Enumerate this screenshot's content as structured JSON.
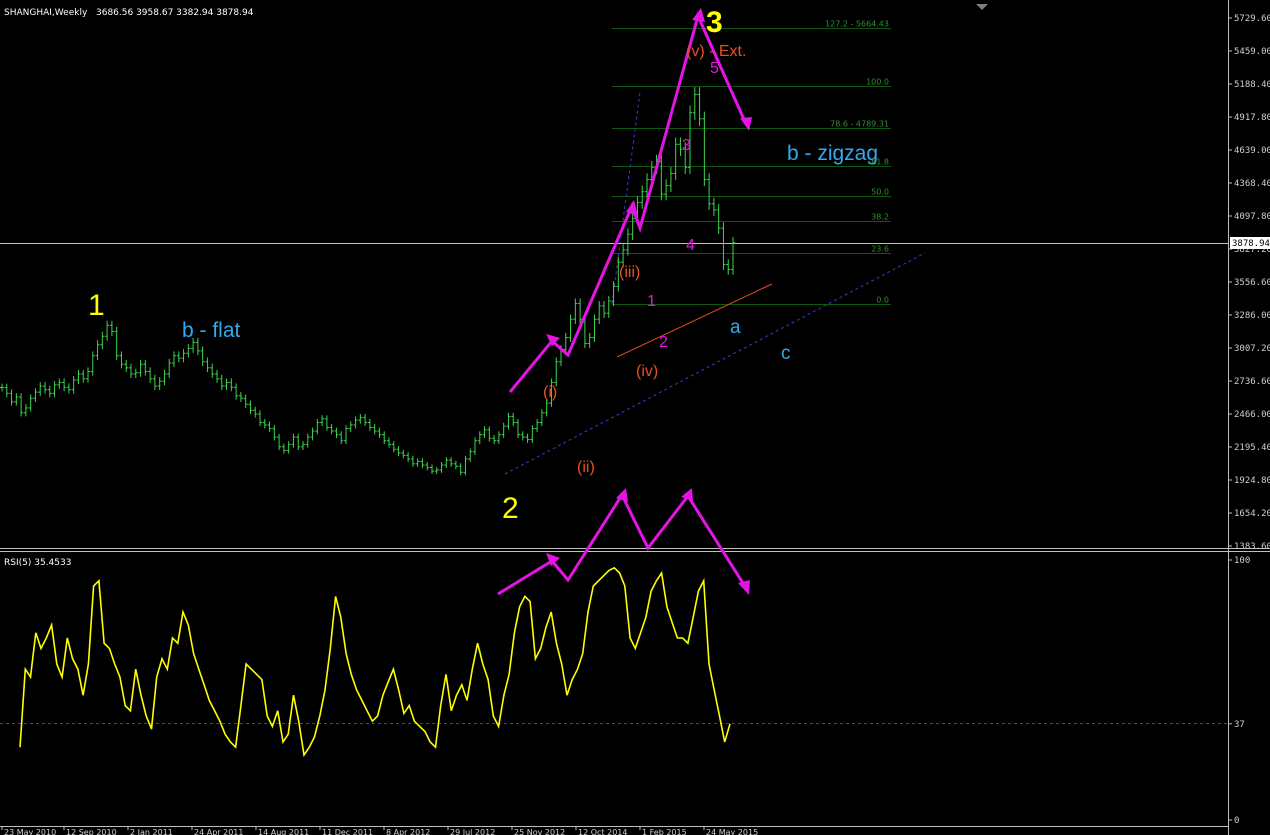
{
  "header": {
    "symbol": "SHANGHAI,Weekly",
    "ohlc": "3686.56 3958.67 3382.94 3878.94"
  },
  "rsi_header": "RSI(5) 35.4533",
  "current_price_label": "3878.94",
  "colors": {
    "background": "#000000",
    "candles": "#3cd64c",
    "rsi_line": "#ffff00",
    "wave_arrows": "#e414e4",
    "fib_lines": "#0f5a0f",
    "trendline": "#3a3ad0",
    "support_line": "#e04a20",
    "primary_wave_labels": "#ffff00",
    "corrective_labels": "#33aaee",
    "minor_wave_labels": "#e85020",
    "minute_wave_labels": "#e414e4"
  },
  "chart_data": [
    {
      "type": "candlestick",
      "title": "SHANGHAI,Weekly",
      "price_axis_ticks": [
        "5729.60",
        "5459.00",
        "5188.40",
        "4917.80",
        "4639.00",
        "4368.40",
        "4097.80",
        "3827.20",
        "3556.60",
        "3286.00",
        "3007.20",
        "2736.60",
        "2466.00",
        "2195.40",
        "1924.80",
        "1654.20",
        "1383.60"
      ],
      "date_axis_ticks": [
        "23 May 2010",
        "12 Sep 2010",
        "2 Jan 2011",
        "24 Apr 2011",
        "14 Aug 2011",
        "11 Dec 2011",
        "8 Apr 2012",
        "29 Jul 2012",
        "25 Nov 2012",
        "12 Oct 2014",
        "1 Feb 2015",
        "24 May 2015"
      ],
      "ylim": [
        1383.6,
        5729.6
      ],
      "weekly_closes": [
        2688,
        2640,
        2570,
        2610,
        2480,
        2520,
        2600,
        2650,
        2700,
        2670,
        2640,
        2710,
        2730,
        2690,
        2670,
        2750,
        2800,
        2760,
        2820,
        2950,
        3040,
        3110,
        3200,
        3150,
        2950,
        2880,
        2850,
        2800,
        2810,
        2880,
        2820,
        2760,
        2700,
        2740,
        2800,
        2890,
        2950,
        2930,
        2970,
        3010,
        3060,
        2990,
        2900,
        2850,
        2800,
        2760,
        2700,
        2730,
        2690,
        2620,
        2600,
        2550,
        2500,
        2470,
        2400,
        2380,
        2350,
        2280,
        2200,
        2170,
        2220,
        2280,
        2200,
        2220,
        2280,
        2330,
        2400,
        2430,
        2360,
        2330,
        2300,
        2250,
        2350,
        2380,
        2420,
        2440,
        2400,
        2360,
        2330,
        2300,
        2250,
        2220,
        2180,
        2150,
        2130,
        2100,
        2060,
        2080,
        2050,
        2030,
        2000,
        2010,
        2050,
        2090,
        2060,
        2040,
        1990,
        2100,
        2160,
        2250,
        2300,
        2340,
        2270,
        2250,
        2300,
        2370,
        2450,
        2400,
        2300,
        2280,
        2260,
        2350,
        2400,
        2480,
        2560,
        2730,
        2900,
        3000,
        3100,
        3250,
        3380,
        3250,
        3050,
        3100,
        3250,
        3360,
        3300,
        3400,
        3520,
        3720,
        3820,
        3950,
        4080,
        4210,
        4300,
        4400,
        4500,
        4550,
        4280,
        4350,
        4450,
        4690,
        4650,
        4500,
        4950,
        5100,
        4900,
        4400,
        4200,
        4150,
        4000,
        3700,
        3660,
        3880
      ],
      "series": [
        {
          "name": "RSI(5)",
          "level_line": 37,
          "axis_ticks": [
            "100",
            "37",
            "0"
          ],
          "values": [
            28,
            58,
            55,
            72,
            66,
            70,
            75,
            60,
            55,
            70,
            62,
            58,
            48,
            60,
            90,
            92,
            68,
            66,
            60,
            55,
            44,
            42,
            58,
            48,
            40,
            35,
            55,
            62,
            58,
            70,
            68,
            80,
            75,
            64,
            58,
            52,
            46,
            42,
            38,
            33,
            30,
            28,
            44,
            60,
            58,
            56,
            54,
            40,
            36,
            42,
            30,
            33,
            48,
            38,
            25,
            28,
            32,
            40,
            50,
            66,
            86,
            78,
            64,
            56,
            50,
            46,
            42,
            38,
            40,
            48,
            53,
            58,
            50,
            41,
            44,
            38,
            36,
            34,
            30,
            28,
            44,
            56,
            42,
            48,
            52,
            46,
            58,
            68,
            60,
            54,
            40,
            36,
            48,
            56,
            72,
            82,
            86,
            84,
            62,
            66,
            74,
            80,
            68,
            60,
            48,
            54,
            58,
            64,
            80,
            90,
            92,
            94,
            96,
            97,
            95,
            90,
            70,
            66,
            72,
            78,
            88,
            92,
            95,
            82,
            76,
            70,
            70,
            68,
            78,
            88,
            92,
            60,
            50,
            40,
            30,
            37
          ]
        }
      ],
      "fibonacci_levels": [
        {
          "label": "127.2 - 5664.43"
        },
        {
          "label": "100.0"
        },
        {
          "label": "78.6 - 4789.31"
        },
        {
          "label": "61.8"
        },
        {
          "label": "50.0"
        },
        {
          "label": "38.2"
        },
        {
          "label": "23.6"
        },
        {
          "label": "0.0"
        }
      ],
      "annotations": {
        "primary": [
          "1",
          "2",
          "3"
        ],
        "corrective": [
          "b - flat",
          "b - zigzag",
          "a",
          "c"
        ],
        "minor": [
          "(i)",
          "(ii)",
          "(iii)",
          "(iv)",
          "(v) - Ext."
        ],
        "minute": [
          "1",
          "2",
          "3",
          "4",
          "5"
        ]
      }
    }
  ]
}
